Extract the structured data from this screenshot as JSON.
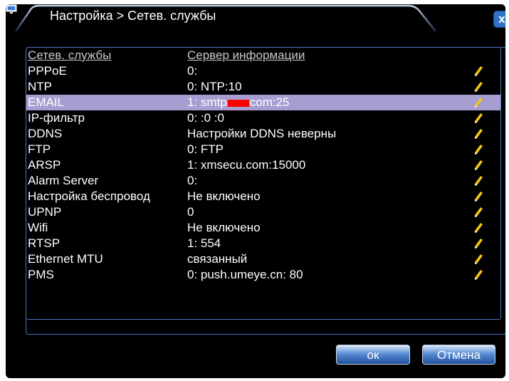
{
  "window": {
    "title": "Настройка > Сетев. службы",
    "close_label": "x",
    "icon": "monitor-icon"
  },
  "table": {
    "headers": {
      "service": "Сетев. службы",
      "info": "Сервер информации"
    },
    "rows": [
      {
        "service": "PPPoE",
        "info": "0:",
        "selected": false
      },
      {
        "service": "NTP",
        "info": "0: NTP:10",
        "selected": false
      },
      {
        "service": "EMAIL",
        "info_prefix": "1: smtp",
        "info_suffix": "com:25",
        "selected": true
      },
      {
        "service": "IP-фильтр",
        "info": "0: :0 :0",
        "selected": false
      },
      {
        "service": "DDNS",
        "info": "Настройки DDNS неверны",
        "selected": false
      },
      {
        "service": "FTP",
        "info": "0: FTP",
        "selected": false
      },
      {
        "service": "ARSP",
        "info": "1: xmsecu.com:15000",
        "selected": false
      },
      {
        "service": "Alarm Server",
        "info": "0:",
        "selected": false
      },
      {
        "service": "Настройка беспровод",
        "info": "Не включено",
        "selected": false
      },
      {
        "service": "UPNP",
        "info": "0",
        "selected": false
      },
      {
        "service": "Wifi",
        "info": "Не включено",
        "selected": false
      },
      {
        "service": "RTSP",
        "info": "1: 554",
        "selected": false
      },
      {
        "service": "Ethernet MTU",
        "info": "связанный",
        "selected": false
      },
      {
        "service": "PMS",
        "info": "0: push.umeye.cn: 80",
        "selected": false
      }
    ],
    "edit_icon": "pencil-icon"
  },
  "buttons": {
    "ok": "ок",
    "cancel": "Отмена"
  },
  "colors": {
    "selected_row": "#a89dd0",
    "accent": "#2f73c9",
    "frame": "#4a78c0",
    "pencil": "#f5c518"
  }
}
